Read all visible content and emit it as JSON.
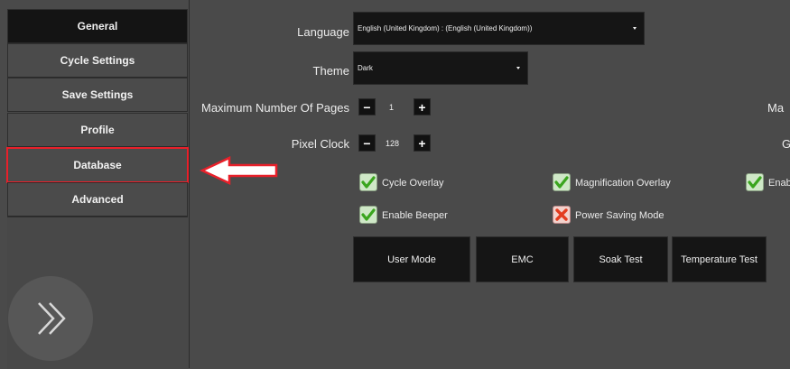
{
  "sidebar": {
    "items": [
      {
        "label": "General"
      },
      {
        "label": "Cycle Settings"
      },
      {
        "label": "Save Settings"
      },
      {
        "label": "Profile"
      },
      {
        "label": "Database"
      },
      {
        "label": "Advanced"
      }
    ],
    "active_item": "General",
    "highlighted_item": "Database",
    "expand_icon": "double-chevron-right-icon"
  },
  "settings": {
    "language_label": "Language",
    "language_value": "English (United Kingdom) :  (English (United Kingdom))",
    "theme_label": "Theme",
    "theme_value": "Dark",
    "max_pages_label": "Maximum Number Of Pages",
    "max_pages_value": "1",
    "pixel_clock_label": "Pixel Clock",
    "pixel_clock_value": "128",
    "cut_label_1": "Ma",
    "cut_label_2": "G"
  },
  "checkboxes": [
    {
      "label": "Cycle Overlay",
      "checked": true
    },
    {
      "label": "Magnification Overlay",
      "checked": true
    },
    {
      "label": "Enab",
      "checked": true
    },
    {
      "label": "Enable Beeper",
      "checked": true
    },
    {
      "label": "Power Saving Mode",
      "checked": false
    }
  ],
  "buttons": {
    "user_mode": "User Mode",
    "emc": "EMC",
    "soak_test": "Soak Test",
    "temperature_test": "Temperature Test"
  },
  "stepper": {
    "minus": "−",
    "plus": "+"
  },
  "colors": {
    "highlight": "#e8202a",
    "check_green": "#4caf2a",
    "cross_red": "#e33b1e",
    "active_nav": "#141414"
  }
}
